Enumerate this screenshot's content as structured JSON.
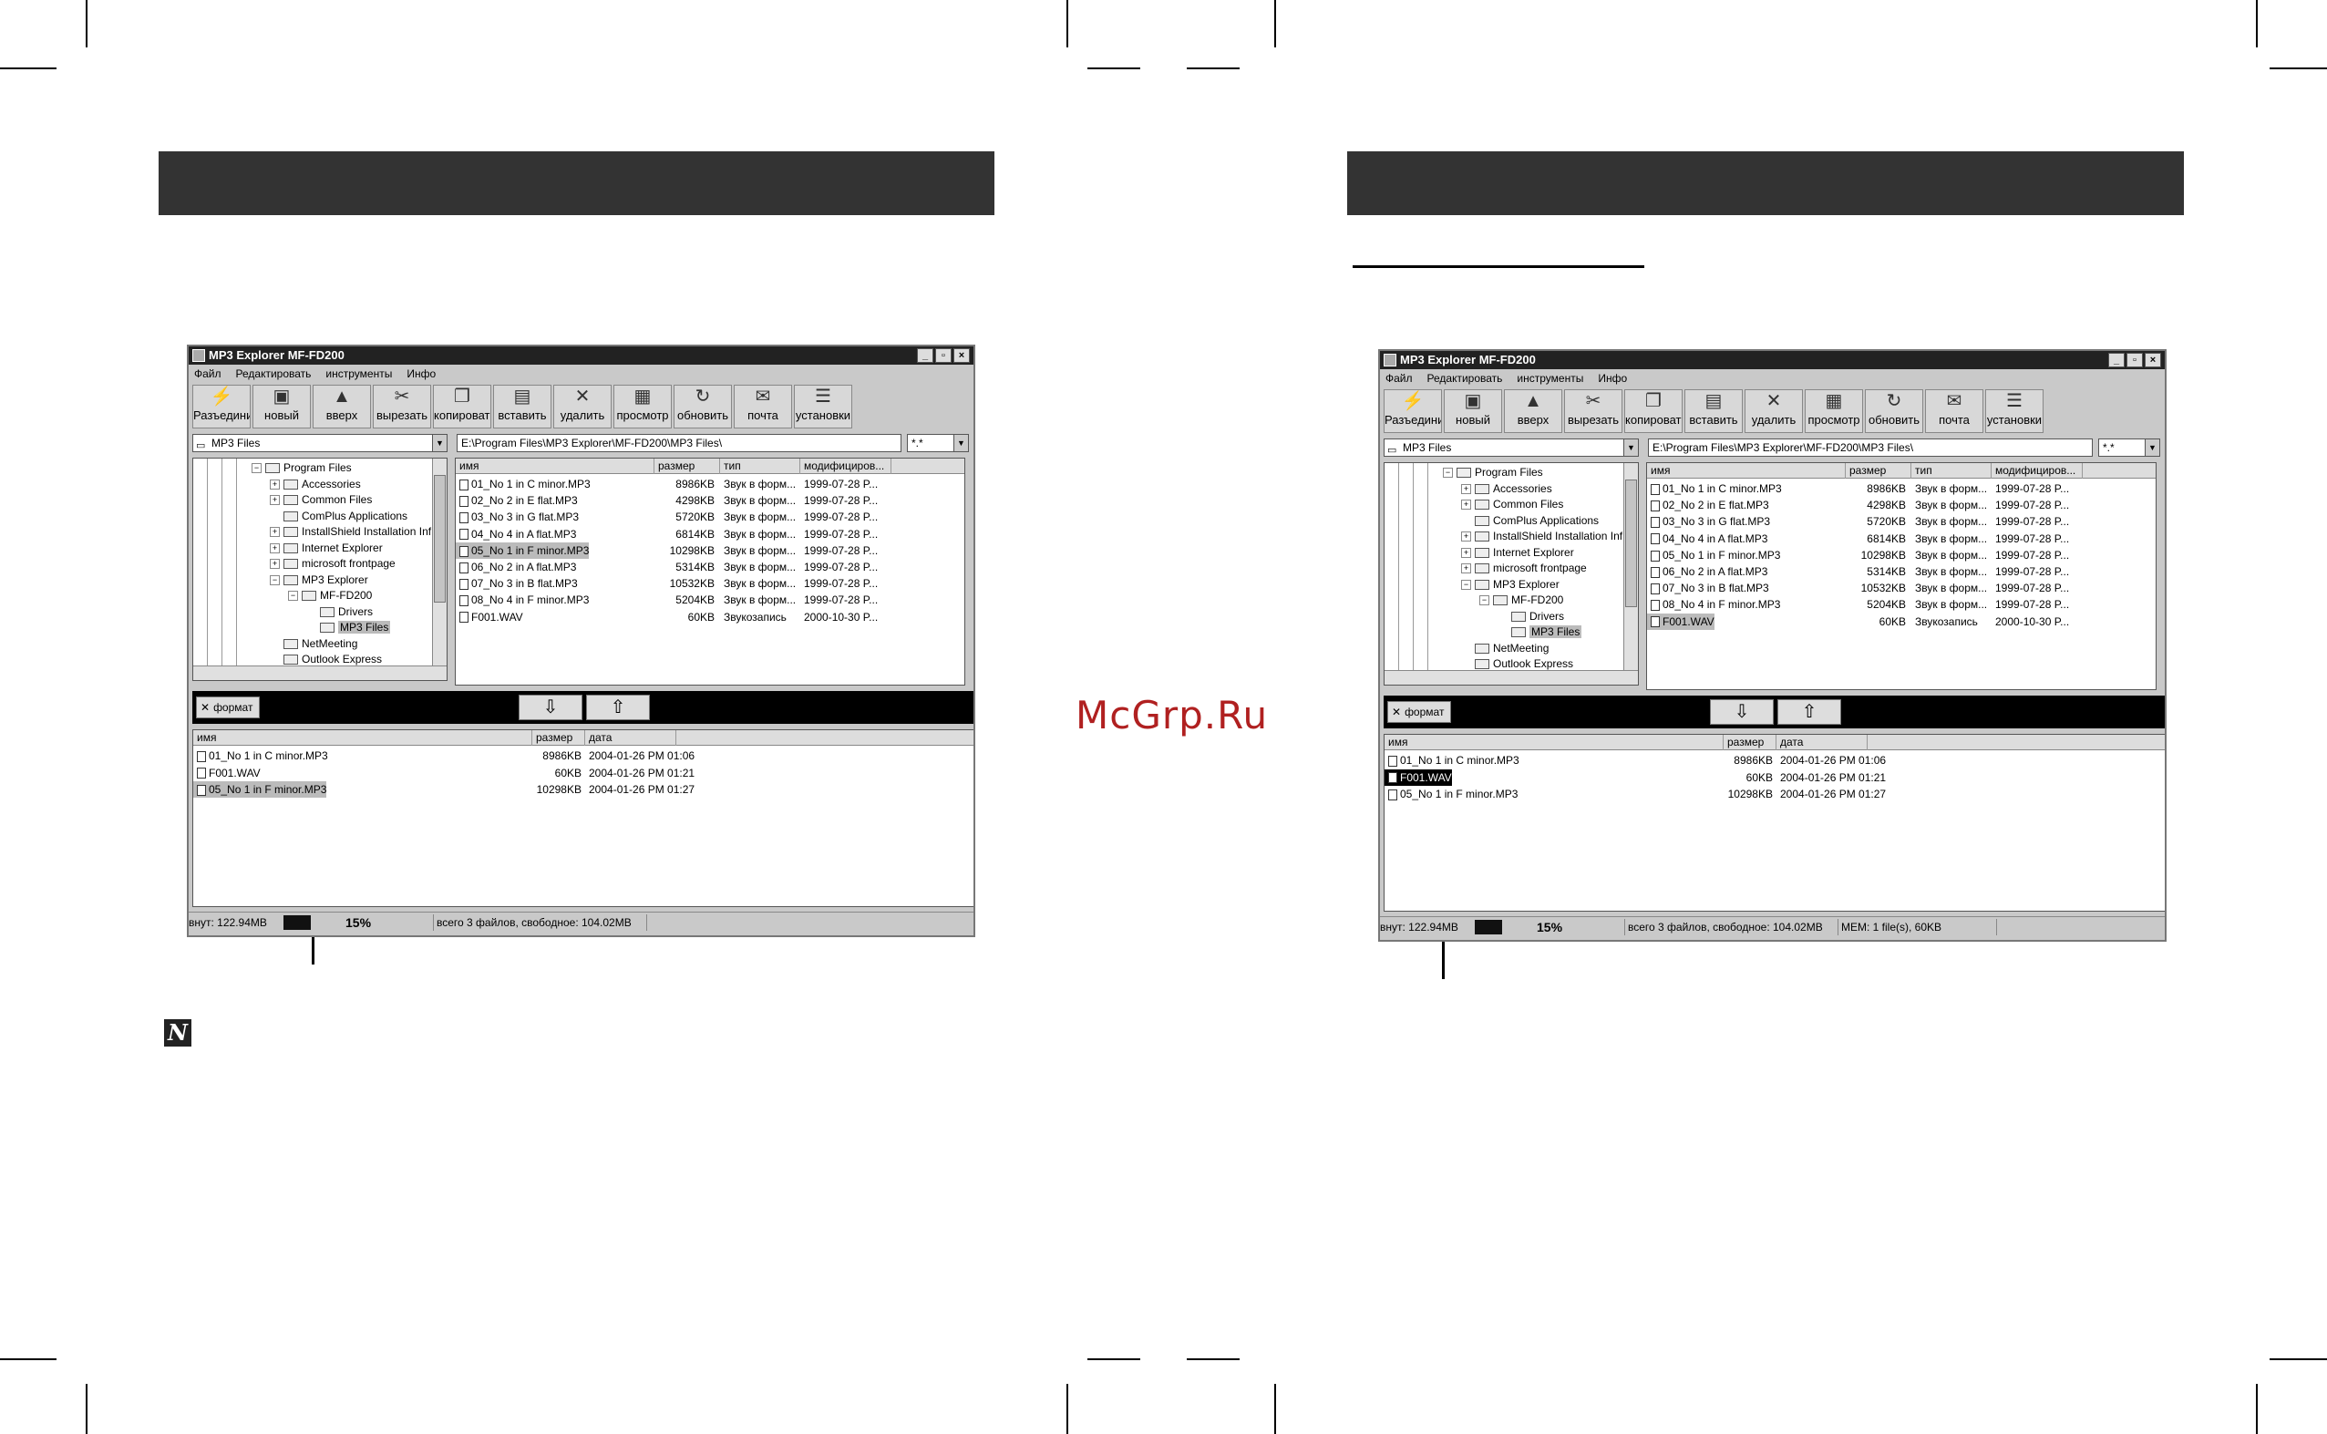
{
  "watermark": "McGrp.Ru",
  "note_icon_glyph": "N",
  "window": {
    "title": "MP3 Explorer MF-FD200",
    "win_buttons": [
      "_",
      "▫",
      "×"
    ],
    "menu": [
      "Файл",
      "Редактировать",
      "инструменты",
      "Инфо"
    ],
    "toolbar": [
      {
        "label": "Разъединить",
        "icon": "disconnect-icon",
        "glyph": "⚡"
      },
      {
        "label": "новый",
        "icon": "new-folder-icon",
        "glyph": "▣"
      },
      {
        "label": "вверх",
        "icon": "up-icon",
        "glyph": "▲"
      },
      {
        "label": "вырезать",
        "icon": "scissors-icon",
        "glyph": "✂"
      },
      {
        "label": "копировать",
        "icon": "copy-icon",
        "glyph": "❐"
      },
      {
        "label": "вставить",
        "icon": "paste-icon",
        "glyph": "▤"
      },
      {
        "label": "удалить",
        "icon": "delete-icon",
        "glyph": "✕"
      },
      {
        "label": "просмотр",
        "icon": "view-icon",
        "glyph": "▦"
      },
      {
        "label": "обновить",
        "icon": "refresh-icon",
        "glyph": "↻"
      },
      {
        "label": "почта",
        "icon": "mail-icon",
        "glyph": "✉"
      },
      {
        "label": "установки",
        "icon": "settings-icon",
        "glyph": "☰"
      }
    ],
    "folder_combo": "MP3 Files",
    "path": "E:\\Program Files\\MP3 Explorer\\MF-FD200\\MP3 Files\\",
    "filter": "*.*",
    "format_button": "формат",
    "download_glyph": "⇩",
    "upload_glyph": "⇧",
    "tree": [
      {
        "label": "Program Files",
        "level": 0,
        "exp": "−"
      },
      {
        "label": "Accessories",
        "level": 1,
        "exp": "+"
      },
      {
        "label": "Common Files",
        "level": 1,
        "exp": "+"
      },
      {
        "label": "ComPlus Applications",
        "level": 1,
        "exp": ""
      },
      {
        "label": "InstallShield Installation Inf",
        "level": 1,
        "exp": "+"
      },
      {
        "label": "Internet Explorer",
        "level": 1,
        "exp": "+"
      },
      {
        "label": "microsoft frontpage",
        "level": 1,
        "exp": "+"
      },
      {
        "label": "MP3 Explorer",
        "level": 1,
        "exp": "−"
      },
      {
        "label": "MF-FD200",
        "level": 2,
        "exp": "−"
      },
      {
        "label": "Drivers",
        "level": 3,
        "exp": ""
      },
      {
        "label": "MP3 Files",
        "level": 3,
        "exp": "",
        "selected": true
      },
      {
        "label": "NetMeeting",
        "level": 1,
        "exp": ""
      },
      {
        "label": "Outlook Express",
        "level": 1,
        "exp": ""
      }
    ],
    "pc_columns": [
      "имя",
      "размер",
      "тип",
      "модифициров..."
    ],
    "pc_files": [
      {
        "name": "01_No 1 in C minor.MP3",
        "size": "8986KB",
        "type": "Звук в форм...",
        "modified": "1999-07-28 P..."
      },
      {
        "name": "02_No 2 in E flat.MP3",
        "size": "4298KB",
        "type": "Звук в форм...",
        "modified": "1999-07-28 P..."
      },
      {
        "name": "03_No 3 in G flat.MP3",
        "size": "5720KB",
        "type": "Звук в форм...",
        "modified": "1999-07-28 P..."
      },
      {
        "name": "04_No 4 in A flat.MP3",
        "size": "6814KB",
        "type": "Звук в форм...",
        "modified": "1999-07-28 P..."
      },
      {
        "name": "05_No 1 in F minor.MP3",
        "size": "10298KB",
        "type": "Звук в форм...",
        "modified": "1999-07-28 P..."
      },
      {
        "name": "06_No 2 in A flat.MP3",
        "size": "5314KB",
        "type": "Звук в форм...",
        "modified": "1999-07-28 P..."
      },
      {
        "name": "07_No 3 in B flat.MP3",
        "size": "10532KB",
        "type": "Звук в форм...",
        "modified": "1999-07-28 P..."
      },
      {
        "name": "08_No 4 in F minor.MP3",
        "size": "5204KB",
        "type": "Звук в форм...",
        "modified": "1999-07-28 P..."
      },
      {
        "name": "F001.WAV",
        "size": "60KB",
        "type": "Звукозапись",
        "modified": "2000-10-30 P..."
      }
    ],
    "dev_columns": [
      "имя",
      "размер",
      "дата"
    ],
    "dev_files_left": [
      {
        "name": "01_No 1 in C minor.MP3",
        "size": "8986KB",
        "date": "2004-01-26 PM 01:06"
      },
      {
        "name": "F001.WAV",
        "size": "60KB",
        "date": "2004-01-26 PM 01:21"
      },
      {
        "name": "05_No 1 in F minor.MP3",
        "size": "10298KB",
        "date": "2004-01-26 PM 01:27"
      }
    ],
    "dev_files_right": [
      {
        "name": "01_No 1 in C minor.MP3",
        "size": "8986KB",
        "date": "2004-01-26 PM 01:06"
      },
      {
        "name": "F001.WAV",
        "size": "60KB",
        "date": "2004-01-26 PM 01:21"
      },
      {
        "name": "05_No 1 in F minor.MP3",
        "size": "10298KB",
        "date": "2004-01-26 PM 01:27"
      }
    ],
    "status": {
      "internal": "внут: 122.94MB",
      "usage": "15%",
      "usage_fraction": 0.15,
      "summary": "всего 3 файлов, свободное: 104.02MB",
      "mem": "MEM: 1 file(s), 60KB"
    }
  }
}
